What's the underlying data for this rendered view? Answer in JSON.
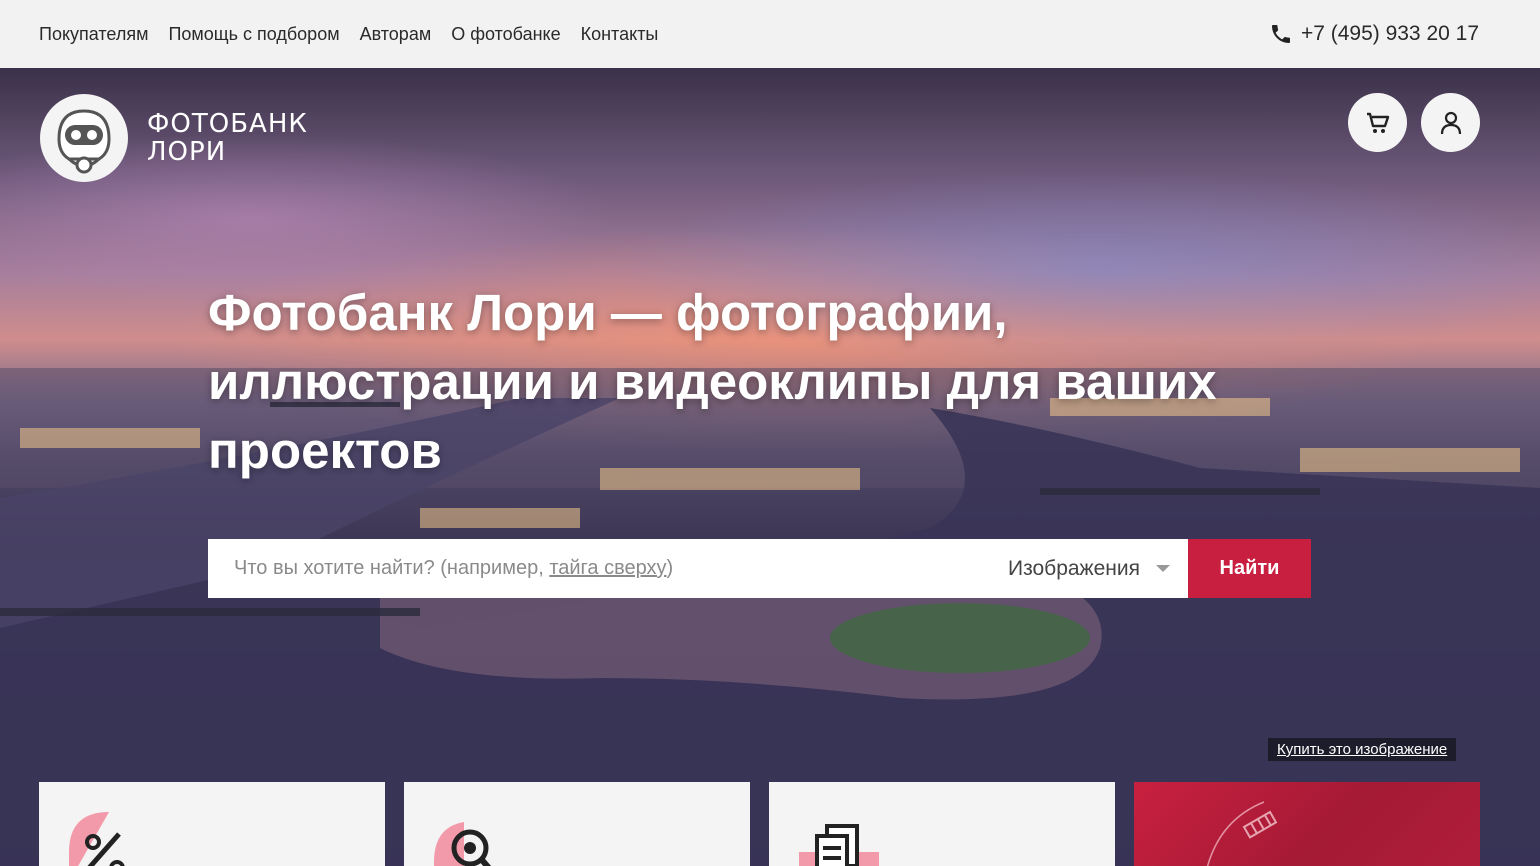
{
  "topnav": {
    "items": [
      "Покупателям",
      "Помощь с подбором",
      "Авторам",
      "О фотобанке",
      "Контакты"
    ],
    "phone": "+7 (495) 933 20 17"
  },
  "logo": {
    "line1": "ФОТОБАНК",
    "line2": "ЛОРИ"
  },
  "header_icons": [
    "cart-icon",
    "user-icon"
  ],
  "hero": {
    "headline_line1": "Фотобанк Лори — фотографии,",
    "headline_line2": "иллюстрации и видеоклипы для ваших",
    "headline_line3": "проектов",
    "search": {
      "placeholder_prefix": "Что вы хотите найти? (например, ",
      "placeholder_example": "тайга сверху",
      "placeholder_suffix": ")",
      "type_selected": "Изображения",
      "submit_label": "Найти"
    },
    "buy_image_link": "Купить это изображение"
  },
  "feature_cards": [
    {
      "icon": "percent-icon"
    },
    {
      "icon": "magnifier-icon"
    },
    {
      "icon": "documents-icon"
    },
    {
      "icon": "promo-banner"
    }
  ],
  "colors": {
    "accent": "#c81e3f",
    "topbar_bg": "#f2f2f2",
    "card_bg": "#f4f4f4"
  }
}
